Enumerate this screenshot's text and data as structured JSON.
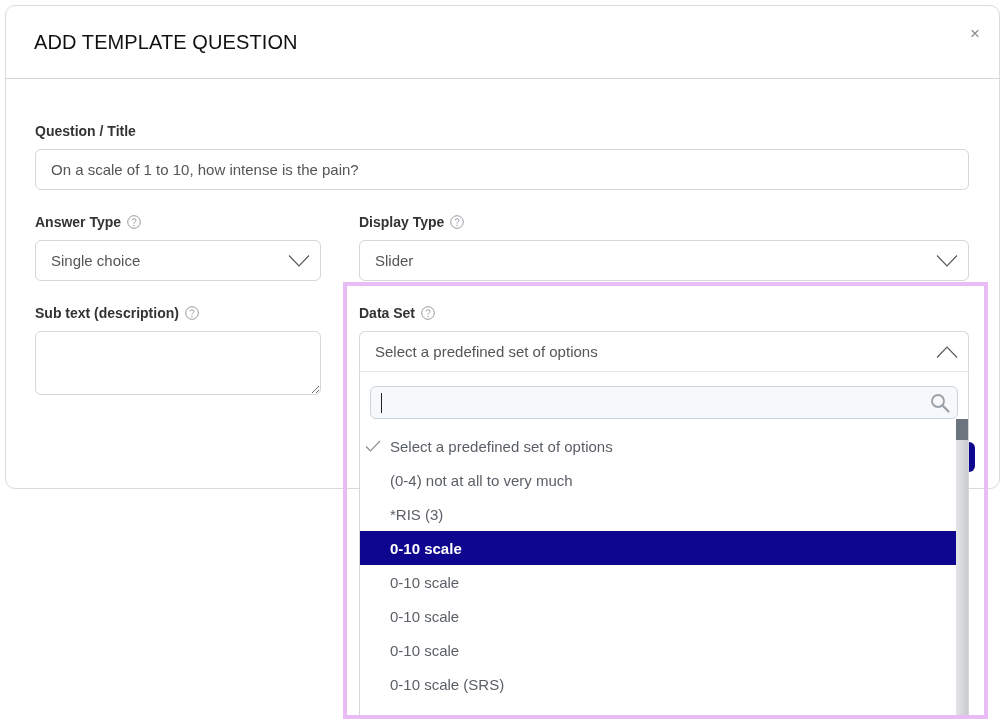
{
  "dialog": {
    "title": "ADD TEMPLATE QUESTION",
    "close": "×"
  },
  "question_title": {
    "label": "Question / Title",
    "value": "On a scale of 1 to 10, how intense is the pain?"
  },
  "answer_type": {
    "label": "Answer Type",
    "value": "Single choice",
    "expanded": false
  },
  "display_type": {
    "label": "Display Type",
    "value": "Slider",
    "expanded": false
  },
  "sub_text": {
    "label": "Sub text (description)"
  },
  "data_set": {
    "label": "Data Set",
    "value": "Select a predefined set of options",
    "expanded": true,
    "options": [
      {
        "label": "Select a predefined set of options",
        "selected": true,
        "highlighted": false
      },
      {
        "label": "(0-4) not at all to very much",
        "selected": false,
        "highlighted": false
      },
      {
        "label": "*RIS (3)",
        "selected": false,
        "highlighted": false
      },
      {
        "label": "0-10 scale",
        "selected": false,
        "highlighted": true
      },
      {
        "label": "0-10 scale",
        "selected": false,
        "highlighted": false
      },
      {
        "label": "0-10 scale",
        "selected": false,
        "highlighted": false
      },
      {
        "label": "0-10 scale",
        "selected": false,
        "highlighted": false
      },
      {
        "label": "0-10 scale (SRS)",
        "selected": false,
        "highlighted": false
      }
    ]
  }
}
